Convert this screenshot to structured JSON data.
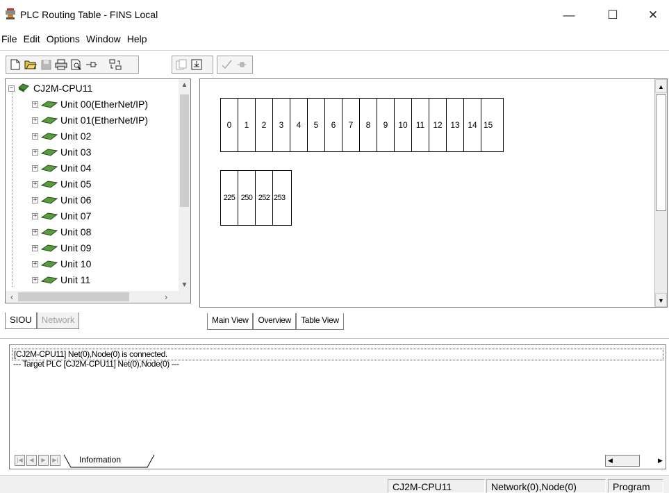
{
  "window": {
    "title": "PLC Routing Table - FINS Local",
    "minimize_glyph": "—",
    "maximize_glyph": "☐",
    "close_glyph": "✕"
  },
  "menu": [
    "File",
    "Edit",
    "Options",
    "Window",
    "Help"
  ],
  "toolbar": {
    "icons": [
      "new-file-icon",
      "open-folder-icon",
      "save-icon",
      "print-icon",
      "print-preview-icon",
      "pin-icon",
      "transfer-icon",
      "copy-document-icon",
      "import-icon",
      "check-icon",
      "connect-icon"
    ]
  },
  "tree": {
    "root": "CJ2M-CPU11",
    "units": [
      "Unit 00(EtherNet/IP)",
      "Unit 01(EtherNet/IP)",
      "Unit 02",
      "Unit 03",
      "Unit 04",
      "Unit 05",
      "Unit 06",
      "Unit 07",
      "Unit 08",
      "Unit 09",
      "Unit 10",
      "Unit 11"
    ]
  },
  "left_tabs": [
    "SIOU",
    "Network"
  ],
  "main_view": {
    "unit_row": [
      "0",
      "1",
      "2",
      "3",
      "4",
      "5",
      "6",
      "7",
      "8",
      "9",
      "10",
      "11",
      "12",
      "13",
      "14",
      "15"
    ],
    "special_row": [
      "225",
      "250",
      "252",
      "253"
    ]
  },
  "main_tabs": [
    "Main View",
    "Overview",
    "Table View"
  ],
  "log": [
    "[CJ2M-CPU11] Net(0),Node(0) is connected.",
    "--- Target PLC [CJ2M-CPU11] Net(0),Node(0) ---"
  ],
  "info_tab": "Information",
  "status": {
    "plc": "CJ2M-CPU11",
    "address": "Network(0),Node(0)",
    "mode": "Program"
  }
}
